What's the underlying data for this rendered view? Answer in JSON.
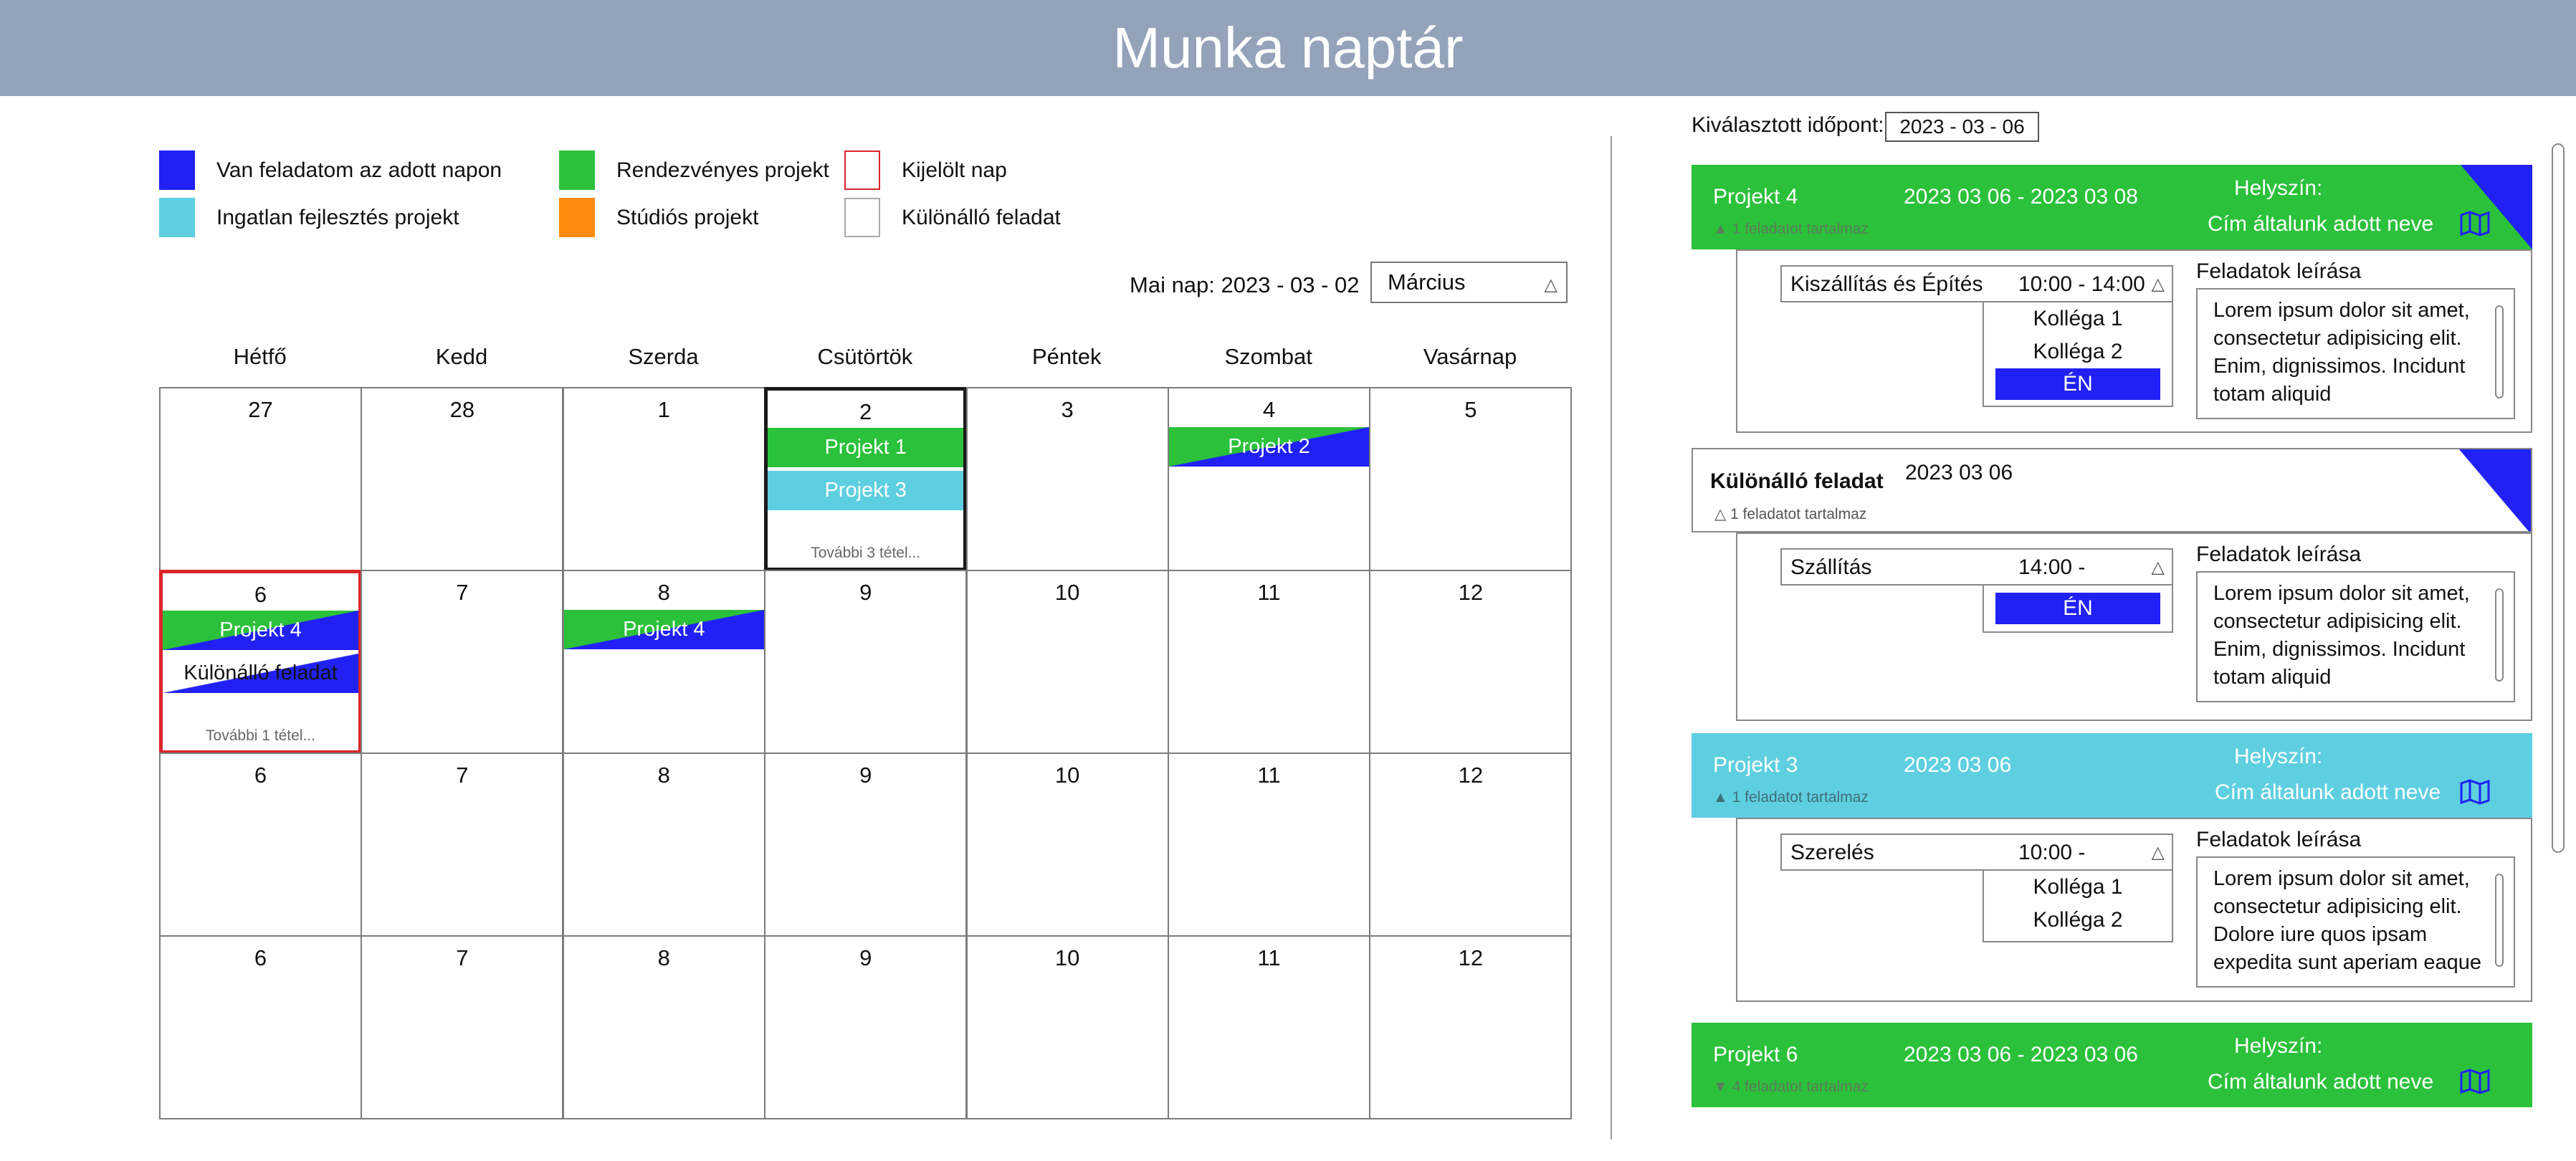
{
  "title": "Munka naptár",
  "legend": [
    {
      "label": "Van feladatom az adott napon",
      "color": "#2121f5"
    },
    {
      "label": "Ingatlan fejlesztés projekt",
      "color": "#5ecfe0"
    },
    {
      "label": "Rendezvényes projekt",
      "color": "#2bc13b"
    },
    {
      "label": "Stúdiós projekt",
      "color": "#ff8c0f"
    },
    {
      "label": "Kijelölt nap",
      "color": "#d9252b"
    },
    {
      "label": "Különálló feladat",
      "color": "#ffffff"
    }
  ],
  "today_label": "Mai nap: 2023 - 03 - 02",
  "month": "Március",
  "weekdays": [
    "Hétfő",
    "Kedd",
    "Szerda",
    "Csütörtök",
    "Péntek",
    "Szombat",
    "Vasárnap"
  ],
  "weeks": [
    [
      "27",
      "28",
      "1",
      "2",
      "3",
      "4",
      "5"
    ],
    [
      "6",
      "7",
      "8",
      "9",
      "10",
      "11",
      "12"
    ],
    [
      "6",
      "7",
      "8",
      "9",
      "10",
      "11",
      "12"
    ],
    [
      "6",
      "7",
      "8",
      "9",
      "10",
      "11",
      "12"
    ]
  ],
  "events": {
    "thu_1": "Projekt 1",
    "thu_2": "Projekt 3",
    "thu_more": "További 3 tétel...",
    "sat": "Projekt 2",
    "mon_1": "Projekt 4",
    "mon_2": "Különálló feladat",
    "mon_more": "További 1 tétel...",
    "wed": "Projekt 4"
  },
  "selected_label": "Kiválasztott időpont:",
  "selected_date": "2023 - 03 - 06",
  "cards": {
    "p4": {
      "name": "Projekt 4",
      "dates": "2023 03 06 - 2023 03 08",
      "location_label": "Helyszín:",
      "address": "Cím általunk adott neve",
      "count": "1 feladatot tartalmaz"
    },
    "p4_detail": {
      "task": "Kiszállítás és Építés",
      "time": "10:00 - 14:00",
      "people": [
        "Kolléga 1",
        "Kolléga 2"
      ],
      "me": "ÉN",
      "desc_title": "Feladatok leírása",
      "desc": "Lorem ipsum dolor sit amet, consectetur adipisicing elit. Enim, dignissimos. Incidunt totam aliquid"
    },
    "sep": {
      "name": "Különálló feladat",
      "dates": "2023 03 06",
      "count": "1 feladatot tartalmaz"
    },
    "sep_detail": {
      "task": "Szállítás",
      "time": "14:00 -",
      "me": "ÉN",
      "desc_title": "Feladatok leírása",
      "desc": "Lorem ipsum dolor sit amet, consectetur adipisicing elit. Enim, dignissimos. Incidunt totam aliquid"
    },
    "p3": {
      "name": "Projekt 3",
      "dates": "2023 03 06",
      "location_label": "Helyszín:",
      "address": "Cím általunk adott neve",
      "count": "1 feladatot tartalmaz"
    },
    "p3_detail": {
      "task": "Szerelés",
      "time": "10:00 -",
      "people": [
        "Kolléga 1",
        "Kolléga 2"
      ],
      "desc_title": "Feladatok leírása",
      "desc": "Lorem ipsum dolor sit amet, consectetur adipisicing elit. Dolore iure quos ipsam expedita sunt aperiam eaque"
    },
    "p6": {
      "name": "Projekt 6",
      "dates": "2023 03 06 - 2023 03 06",
      "location_label": "Helyszín:",
      "address": "Cím általunk adott neve",
      "count": "4 feladatot tartalmaz"
    }
  }
}
